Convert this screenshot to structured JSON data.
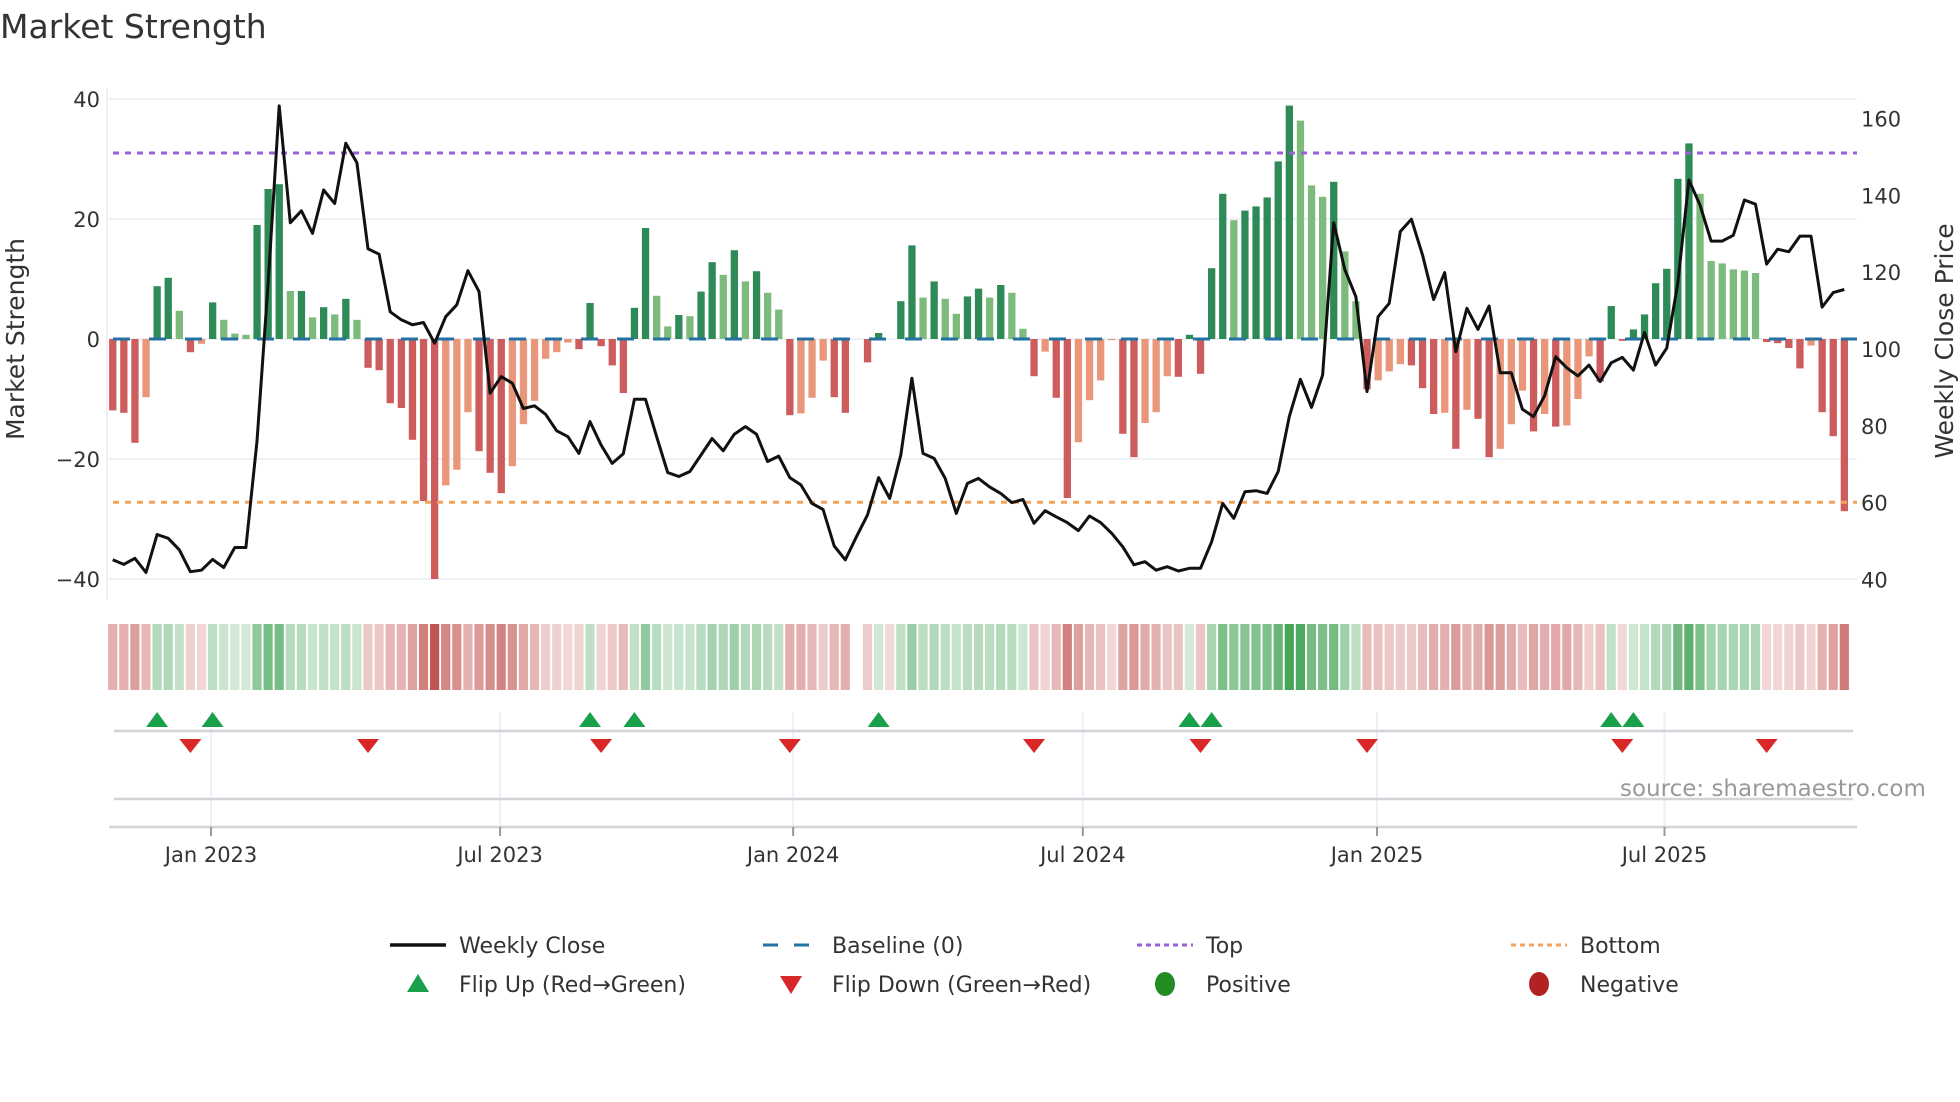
{
  "chart_data": {
    "type": "bar",
    "title": "Market Strength",
    "ylabel": "Market Strength",
    "y2label": "Weekly Close Price",
    "ylim": [
      -40,
      40
    ],
    "y2lim": [
      40,
      160
    ],
    "y_ticks": [
      "40",
      "20",
      "0",
      "−20",
      "−40"
    ],
    "y_tick_values": [
      40,
      20,
      0,
      -20,
      -40
    ],
    "y2_ticks": [
      "160",
      "140",
      "120",
      "100",
      "80",
      "60",
      "40"
    ],
    "y2_tick_values": [
      160,
      140,
      120,
      100,
      80,
      60,
      40
    ],
    "x_ticks": [
      {
        "label": "Jan 2023",
        "week": 8.86
      },
      {
        "label": "Jul 2023",
        "week": 34.9
      },
      {
        "label": "Jan 2024",
        "week": 61.3
      },
      {
        "label": "Jul 2024",
        "week": 87.4
      },
      {
        "label": "Jan 2025",
        "week": 113.9
      },
      {
        "label": "Jul 2025",
        "week": 139.8
      }
    ],
    "top_level": 31,
    "bottom_level": -27.2,
    "baseline": 0,
    "strength": [
      -11.9,
      -12.3,
      -17.3,
      -9.7,
      8.8,
      10.2,
      4.7,
      -2.2,
      -0.8,
      6.1,
      3.2,
      0.9,
      0.7,
      19,
      25,
      25.8,
      8,
      8,
      3.6,
      5.3,
      4.1,
      6.7,
      3.2,
      -4.8,
      -5.2,
      -10.7,
      -11.5,
      -16.8,
      -27,
      -40,
      -24.4,
      -21.8,
      -12.2,
      -18.7,
      -22.3,
      -25.7,
      -21.2,
      -14.2,
      -10.3,
      -3.3,
      -2.2,
      -0.6,
      -1.7,
      6,
      -1.2,
      -4.4,
      -9,
      5.2,
      18.5,
      7.2,
      2.1,
      4,
      3.8,
      7.9,
      12.8,
      10.7,
      14.8,
      9.6,
      11.3,
      7.7,
      4.9,
      -12.7,
      -12.4,
      -9.8,
      -3.6,
      -9.7,
      -12.3,
      null,
      -3.9,
      1,
      0,
      6.3,
      15.6,
      6.9,
      9.6,
      6.7,
      4.2,
      7.1,
      8.4,
      6.9,
      9,
      7.7,
      1.7,
      -6.2,
      -2.1,
      -9.8,
      -26.5,
      -17.2,
      -10.2,
      -6.9,
      -0.2,
      -15.8,
      -19.7,
      -14,
      -12.2,
      -6.2,
      -6.3,
      0.7,
      -5.8,
      11.8,
      24.2,
      19.8,
      21.4,
      22.1,
      23.6,
      29.6,
      38.9,
      36.4,
      25.6,
      23.7,
      26.2,
      14.6,
      6.3,
      -8.4,
      -6.9,
      -5.4,
      -4.2,
      -4.4,
      -8.2,
      -12.5,
      -12.3,
      -18.3,
      -11.8,
      -13.3,
      -19.7,
      -18.3,
      -14.2,
      -8.6,
      -15.4,
      -12.5,
      -14.6,
      -14.4,
      -10,
      -2.9,
      -7.1,
      5.5,
      -0.3,
      1.6,
      4.1,
      9.3,
      11.7,
      26.7,
      32.6,
      24.2,
      13,
      12.6,
      11.6,
      11.4,
      11,
      -0.5,
      -0.7,
      -1.5,
      -4.9,
      -1.1,
      -12.2,
      -16.2,
      -28.7
    ],
    "weekly_close": [
      45.1,
      43.9,
      45.5,
      41.8,
      51.7,
      50.7,
      47.7,
      42,
      42.4,
      45.2,
      43.1,
      48.3,
      48.3,
      76,
      117,
      163.3,
      132.9,
      136,
      130.1,
      141.4,
      137.9,
      153.6,
      148.5,
      126.1,
      124.7,
      109.7,
      107.6,
      106.3,
      106.9,
      101.5,
      108.4,
      111.5,
      120.4,
      115,
      88.5,
      92.8,
      91.1,
      84.5,
      85.2,
      83,
      78.7,
      77.2,
      72.8,
      81.1,
      75,
      70.2,
      72.7,
      86.9,
      86.9,
      77.2,
      67.8,
      66.8,
      68.1,
      72.4,
      76.7,
      73.5,
      77.8,
      79.8,
      77.8,
      70.7,
      72.1,
      66.5,
      64.6,
      59.8,
      58.2,
      48.7,
      45.1,
      51.1,
      56.8,
      66.5,
      61.1,
      72.4,
      92.4,
      72.8,
      71.5,
      66.3,
      57.2,
      65,
      66.3,
      64.1,
      62.4,
      60,
      60.8,
      54.6,
      57.9,
      56.3,
      54.8,
      52.7,
      56.5,
      54.8,
      52,
      48.5,
      43.8,
      44.6,
      42.4,
      43.3,
      42.2,
      42.9,
      42.9,
      49.8,
      59.8,
      55.9,
      62.8,
      63.1,
      62.4,
      68.1,
      82.4,
      92.1,
      84.8,
      93.2,
      132.9,
      120.7,
      113.6,
      88.9,
      108.4,
      111.9,
      130.6,
      133.8,
      124.5,
      112.9,
      119.9,
      99.3,
      110.6,
      105.1,
      111.2,
      93.8,
      93.8,
      84.3,
      82.4,
      87.8,
      98,
      95.1,
      93,
      95.8,
      91.5,
      96.4,
      97.8,
      94.5,
      104.3,
      95.8,
      100.2,
      117.1,
      144,
      137.5,
      128.1,
      128.1,
      129.6,
      138.8,
      137.7,
      122.1,
      126,
      125.3,
      129.4,
      129.4,
      110.9,
      114.7,
      115.5
    ],
    "flip_up_weeks": [
      4,
      9,
      43,
      47,
      69,
      97,
      99,
      135,
      137
    ],
    "flip_down_weeks": [
      7,
      23,
      44,
      61,
      83,
      98,
      113,
      136,
      149
    ],
    "legend": {
      "placement": "bottom",
      "items": [
        {
          "label": "Weekly Close",
          "symbol": "line"
        },
        {
          "label": "Baseline (0)",
          "symbol": "dash"
        },
        {
          "label": "Top",
          "symbol": "dot-purple"
        },
        {
          "label": "Bottom",
          "symbol": "dot-orange"
        },
        {
          "label": "Flip Up (Red→Green)",
          "symbol": "tri-up"
        },
        {
          "label": "Flip Down (Green→Red)",
          "symbol": "tri-down"
        },
        {
          "label": "Positive",
          "symbol": "circle-green"
        },
        {
          "label": "Negative",
          "symbol": "circle-red"
        }
      ]
    },
    "annotation": "source: sharemaestro.com",
    "colors": {
      "pos_strong": "#2e8b57",
      "pos_weak": "#7dbb7d",
      "neg_strong": "#cd5c5c",
      "neg_weak": "#e9967a",
      "price": "#111111",
      "baseline": "#2471a3",
      "top": "#9b5fd6",
      "bottom": "#f0a35e",
      "flip_up": "#18a04a",
      "flip_down": "#d92626",
      "positive": "#228b22",
      "negative": "#b22222",
      "grid": "#edf0f4"
    }
  }
}
